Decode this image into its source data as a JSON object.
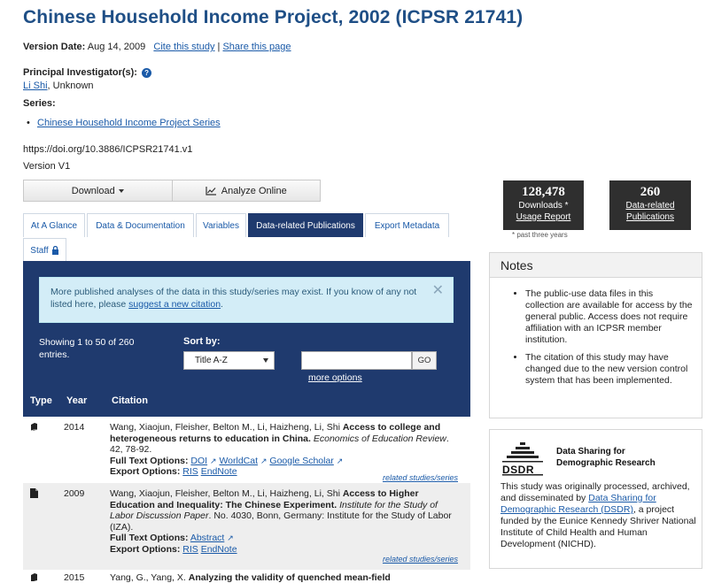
{
  "page_title": "Chinese Household Income Project, 2002 (ICPSR 21741)",
  "version_date_label": "Version Date:",
  "version_date": "Aug 14, 2009",
  "cite_link": "Cite this study",
  "share_link": "Share this page",
  "separator": "|",
  "pi_label": "Principal Investigator(s):",
  "pi_help_glyph": "?",
  "pi_name": "Li Shi",
  "pi_affiliation": ", Unknown",
  "series_label": "Series:",
  "series_item": "Chinese Household Income Project Series",
  "doi": "https://doi.org/10.3886/ICPSR21741.v1",
  "version": "Version V1",
  "buttons": {
    "download": "Download",
    "analyze": "Analyze Online"
  },
  "tabs": [
    {
      "label": "At A Glance"
    },
    {
      "label": "Data & Documentation"
    },
    {
      "label": "Variables"
    },
    {
      "label": "Data-related Publications"
    },
    {
      "label": "Export Metadata"
    },
    {
      "label": "Staff"
    }
  ],
  "alert": {
    "text": "More published analyses of the data in this study/series may exist. If you know of any not listed here, please ",
    "link": "suggest a new citation",
    "end": ".",
    "close": "✕"
  },
  "listing": {
    "showing": "Showing 1 to 50 of 260 entries.",
    "sort_label": "Sort by:",
    "sort_value": "Title A-Z",
    "search_value": "",
    "go": "GO",
    "more_options": "more options"
  },
  "table_headers": {
    "type": "Type",
    "year": "Year",
    "citation": "Citation"
  },
  "labels": {
    "full_text": "Full Text Options:",
    "export": "Export Options:",
    "ris": "RIS",
    "endnote": "EndNote",
    "related": "related studies/series",
    "ext": "↗"
  },
  "rows": [
    {
      "type_icon": "journal-icon",
      "year": "2014",
      "authors": "Wang, Xiaojun, Fleisher, Belton M., Li, Haizheng, Li, Shi ",
      "title": "Access to college and heterogeneous returns to education in China.",
      "journal": "Economics of Education Review",
      "details": ". 42, 78-92.",
      "full_text_links": [
        "DOI",
        "WorldCat",
        "Google Scholar"
      ]
    },
    {
      "type_icon": "document-icon",
      "year": "2009",
      "authors": "Wang, Xiaojun, Fleisher, Belton M., Li, Haizheng, Li, Shi ",
      "title": "Access to Higher Education and Inequality: The Chinese Experiment.",
      "journal": "Institute for the Study of Labor Discussion Paper",
      "details": ". No. 4030, Bonn, Germany: Institute for the Study of Labor (IZA).",
      "full_text_links": [
        "Abstract"
      ]
    },
    {
      "type_icon": "journal-icon",
      "year": "2015",
      "authors": "Yang, G., Yang, X. ",
      "title": "Analyzing the validity of quenched mean-field"
    }
  ],
  "stats": {
    "downloads_number": "128,478",
    "downloads_label": "Downloads *",
    "usage_report": "Usage Report",
    "pubs_number": "260",
    "pubs_label_1": "Data-related",
    "pubs_label_2": "Publications",
    "footnote": "* past three years"
  },
  "notes": {
    "heading": "Notes",
    "items": [
      "The public-use data files in this collection are available for access by the general public. Access does not require affiliation with an ICPSR member institution.",
      "The citation of this study may have changed due to the new version control system that has been implemented."
    ]
  },
  "dsdr": {
    "logo_line1": "Data Sharing for",
    "logo_line2": "Demographic Research",
    "logo_acronym": "DSDR",
    "text_1": "This study was originally processed, archived, and disseminated by ",
    "link": "Data Sharing for Demographic Research (DSDR)",
    "text_2": ", a project funded by the Eunice Kennedy Shriver National Institute of Child Health and Human Development (NICHD)."
  },
  "colors": {
    "navy": "#1f3a6e",
    "title_blue": "#1f4f86",
    "link_blue": "#1a5aa8",
    "alert_bg": "#d3edf7",
    "stat_bg": "#2f2f2f"
  }
}
